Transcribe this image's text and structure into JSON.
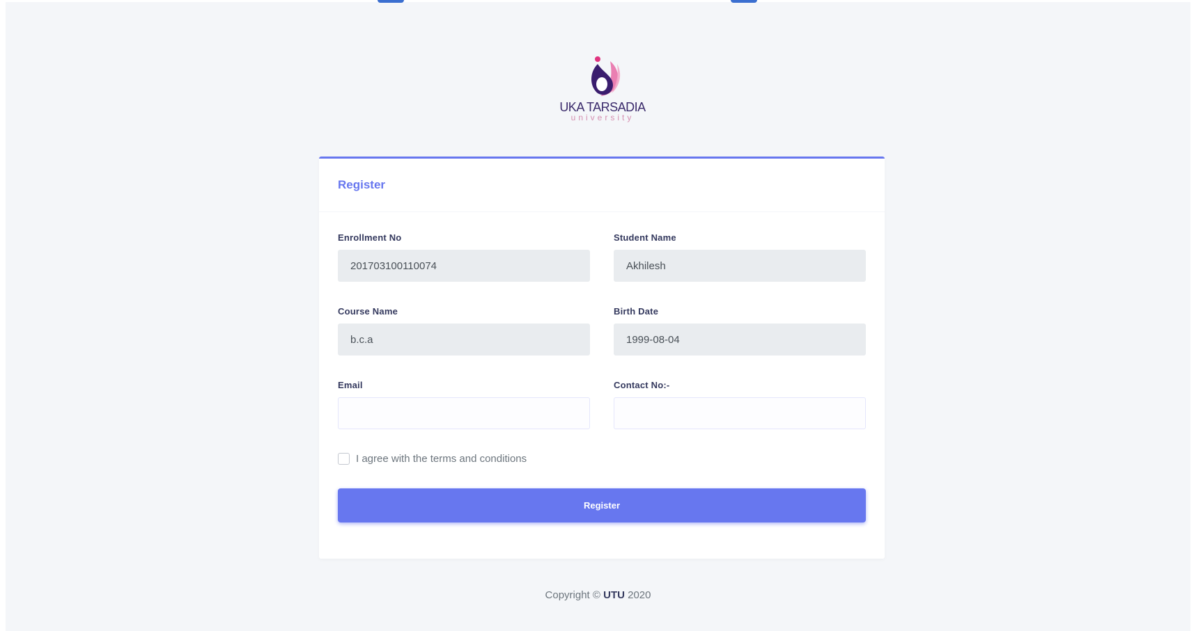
{
  "logo": {
    "title": "UKA TARSADIA",
    "subtitle": "university"
  },
  "form": {
    "title": "Register",
    "fields": [
      {
        "label": "Enrollment No",
        "value": "201703100110074",
        "placeholder": ""
      },
      {
        "label": "Student Name",
        "value": "Akhilesh",
        "placeholder": ""
      },
      {
        "label": "Course Name",
        "value": "b.c.a",
        "placeholder": ""
      },
      {
        "label": "Birth Date",
        "value": "1999-08-04",
        "placeholder": ""
      },
      {
        "label": "Email",
        "value": "",
        "placeholder": ""
      },
      {
        "label": "Contact No:-",
        "value": "",
        "placeholder": ""
      }
    ],
    "terms_label": "I agree with the terms and conditions",
    "terms_checked": false,
    "submit_label": "Register"
  },
  "footer": {
    "prefix": "Copyright ©",
    "brand": "UTU",
    "year": "2020"
  },
  "colors": {
    "accent": "#6777ef",
    "background": "#f4f6f9",
    "readonly_bg": "#e9ecef"
  },
  "icons": {
    "logo": "uka-tarsadia-logo-icon",
    "checkbox": "checkbox-icon"
  }
}
